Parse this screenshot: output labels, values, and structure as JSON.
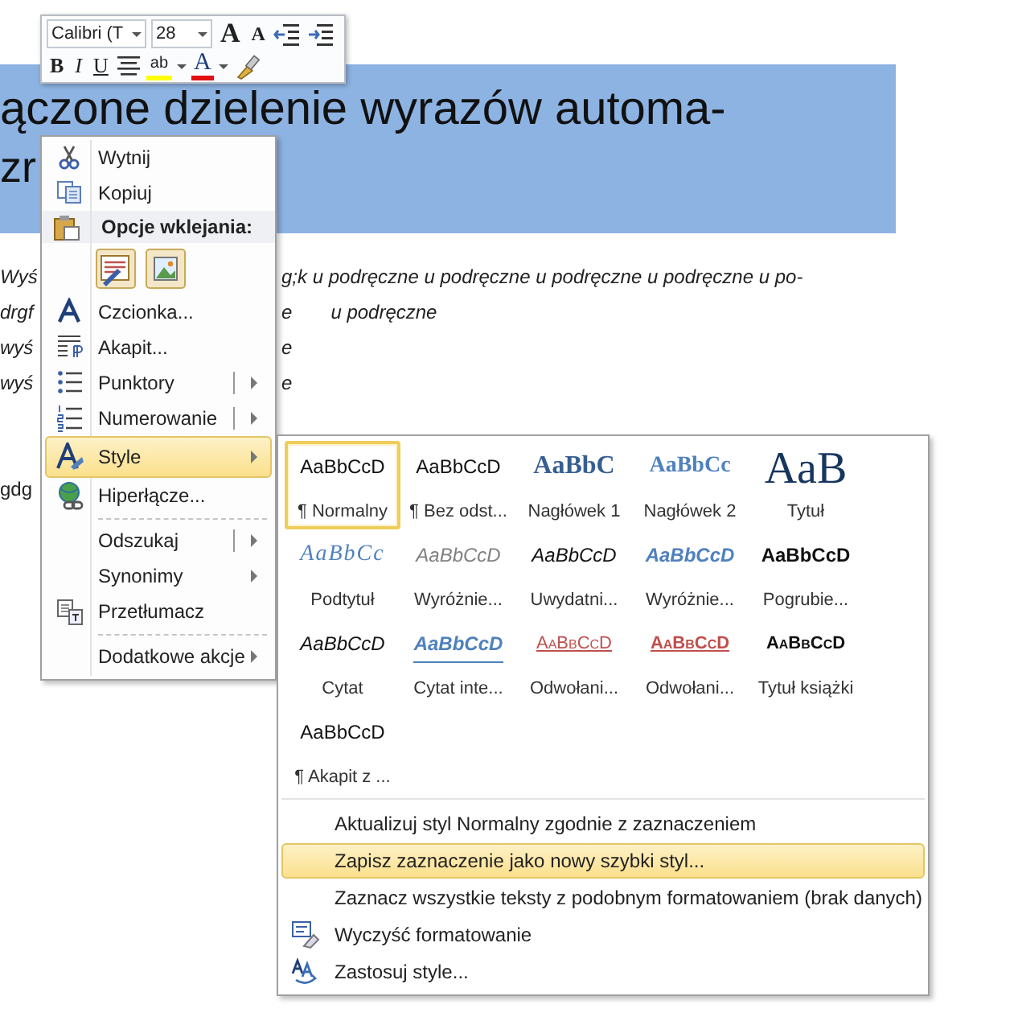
{
  "document": {
    "heading_lines": [
      "ączone dzielenie  wyrazów automa-",
      "zr"
    ],
    "body_lines": [
      {
        "left": "Wyś",
        "right": [
          "g;k u podręczne u podręczne u podręczne u podręczne u po-"
        ],
        "italic": true
      },
      {
        "left": "drgf",
        "right": [
          "e",
          "u podręczne"
        ],
        "italic": true
      },
      {
        "left": "wyś",
        "right": [
          "e"
        ],
        "italic": true
      },
      {
        "left": "wyś",
        "right": [
          "e"
        ],
        "italic": true
      },
      {
        "left": "gdg",
        "italic": false
      }
    ]
  },
  "mini_toolbar": {
    "font": "Calibri (T",
    "size": "28",
    "grow_font": "A",
    "shrink_font": "A",
    "bold": "B",
    "italic": "I",
    "underline": "U",
    "highlight": "ab",
    "font_color": "A"
  },
  "context_menu": {
    "items": [
      {
        "kind": "command",
        "label": "Wytnij",
        "selected": false,
        "separator_before": false
      },
      {
        "kind": "command",
        "label": "Kopiuj",
        "selected": false,
        "separator_before": false
      },
      {
        "kind": "header",
        "label": "Opcje wklejania:"
      },
      {
        "kind": "paste-options"
      },
      {
        "kind": "command",
        "label": "Czcionka...",
        "selected": false,
        "separator_before": false
      },
      {
        "kind": "command",
        "label": "Akapit...",
        "selected": false,
        "separator_before": false
      },
      {
        "kind": "split",
        "label": "Punktory",
        "selected": false,
        "separator_before": false
      },
      {
        "kind": "split",
        "label": "Numerowanie",
        "selected": false,
        "separator_before": false
      },
      {
        "kind": "submenu",
        "label": "Style",
        "selected": true,
        "separator_before": false
      },
      {
        "kind": "command",
        "label": "Hiperłącze...",
        "selected": false,
        "separator_before": false
      },
      {
        "kind": "split",
        "label": "Odszukaj",
        "selected": false,
        "separator_before": true
      },
      {
        "kind": "submenu",
        "label": "Synonimy",
        "selected": false,
        "separator_before": false
      },
      {
        "kind": "command",
        "label": "Przetłumacz",
        "selected": false,
        "separator_before": false
      },
      {
        "kind": "submenu",
        "label": "Dodatkowe akcje",
        "selected": false,
        "separator_before": true
      }
    ]
  },
  "styles_submenu": {
    "gallery": [
      {
        "kind": "normal",
        "preview": "AaBbCcD",
        "name": "¶ Normalny",
        "selected": true
      },
      {
        "kind": "normal",
        "preview": "AaBbCcD",
        "name": "¶ Bez odst...",
        "selected": false
      },
      {
        "kind": "heading1",
        "preview": "AaBbC",
        "name": "Nagłówek 1",
        "selected": false
      },
      {
        "kind": "heading2",
        "preview": "AaBbCc",
        "name": "Nagłówek 2",
        "selected": false
      },
      {
        "kind": "title",
        "preview": "AaB",
        "name": "Tytuł",
        "selected": false
      },
      {
        "kind": "subtitle",
        "preview": "AaBbCc",
        "name": "Podtytuł",
        "selected": false
      },
      {
        "kind": "subtle-emphasis",
        "preview": "AaBbCcD",
        "name": "Wyróżnie...",
        "selected": false
      },
      {
        "kind": "emphasis",
        "preview": "AaBbCcD",
        "name": "Uwydatni...",
        "selected": false
      },
      {
        "kind": "intense-emphasis",
        "preview": "AaBbCcD",
        "name": "Wyróżnie...",
        "selected": false
      },
      {
        "kind": "strong",
        "preview": "AaBbCcD",
        "name": "Pogrubie...",
        "selected": false
      },
      {
        "kind": "quote",
        "preview": "AaBbCcD",
        "name": "Cytat",
        "selected": false
      },
      {
        "kind": "intense-quote",
        "preview": "AaBbCcD",
        "name": "Cytat inte...",
        "selected": false
      },
      {
        "kind": "subtle-reference",
        "preview": "AaBbCcD",
        "name": "Odwołani...",
        "selected": false
      },
      {
        "kind": "intense-reference",
        "preview": "AaBbCcD",
        "name": "Odwołani...",
        "selected": false
      },
      {
        "kind": "book-title",
        "preview": "AaBbCcD",
        "name": "Tytuł książki",
        "selected": false
      },
      {
        "kind": "normal",
        "preview": "AaBbCcD",
        "name": "¶ Akapit z ...",
        "selected": false
      }
    ],
    "items": [
      {
        "label": "Aktualizuj styl Normalny zgodnie z zaznaczeniem",
        "selected": false
      },
      {
        "label": "Zapisz zaznaczenie jako nowy szybki styl...",
        "selected": true
      },
      {
        "label": "Zaznacz wszystkie teksty z podobnym formatowaniem (brak danych)",
        "selected": false
      },
      {
        "label": "Wyczyść formatowanie",
        "selected": false
      },
      {
        "label": "Zastosuj style...",
        "selected": false
      }
    ]
  }
}
